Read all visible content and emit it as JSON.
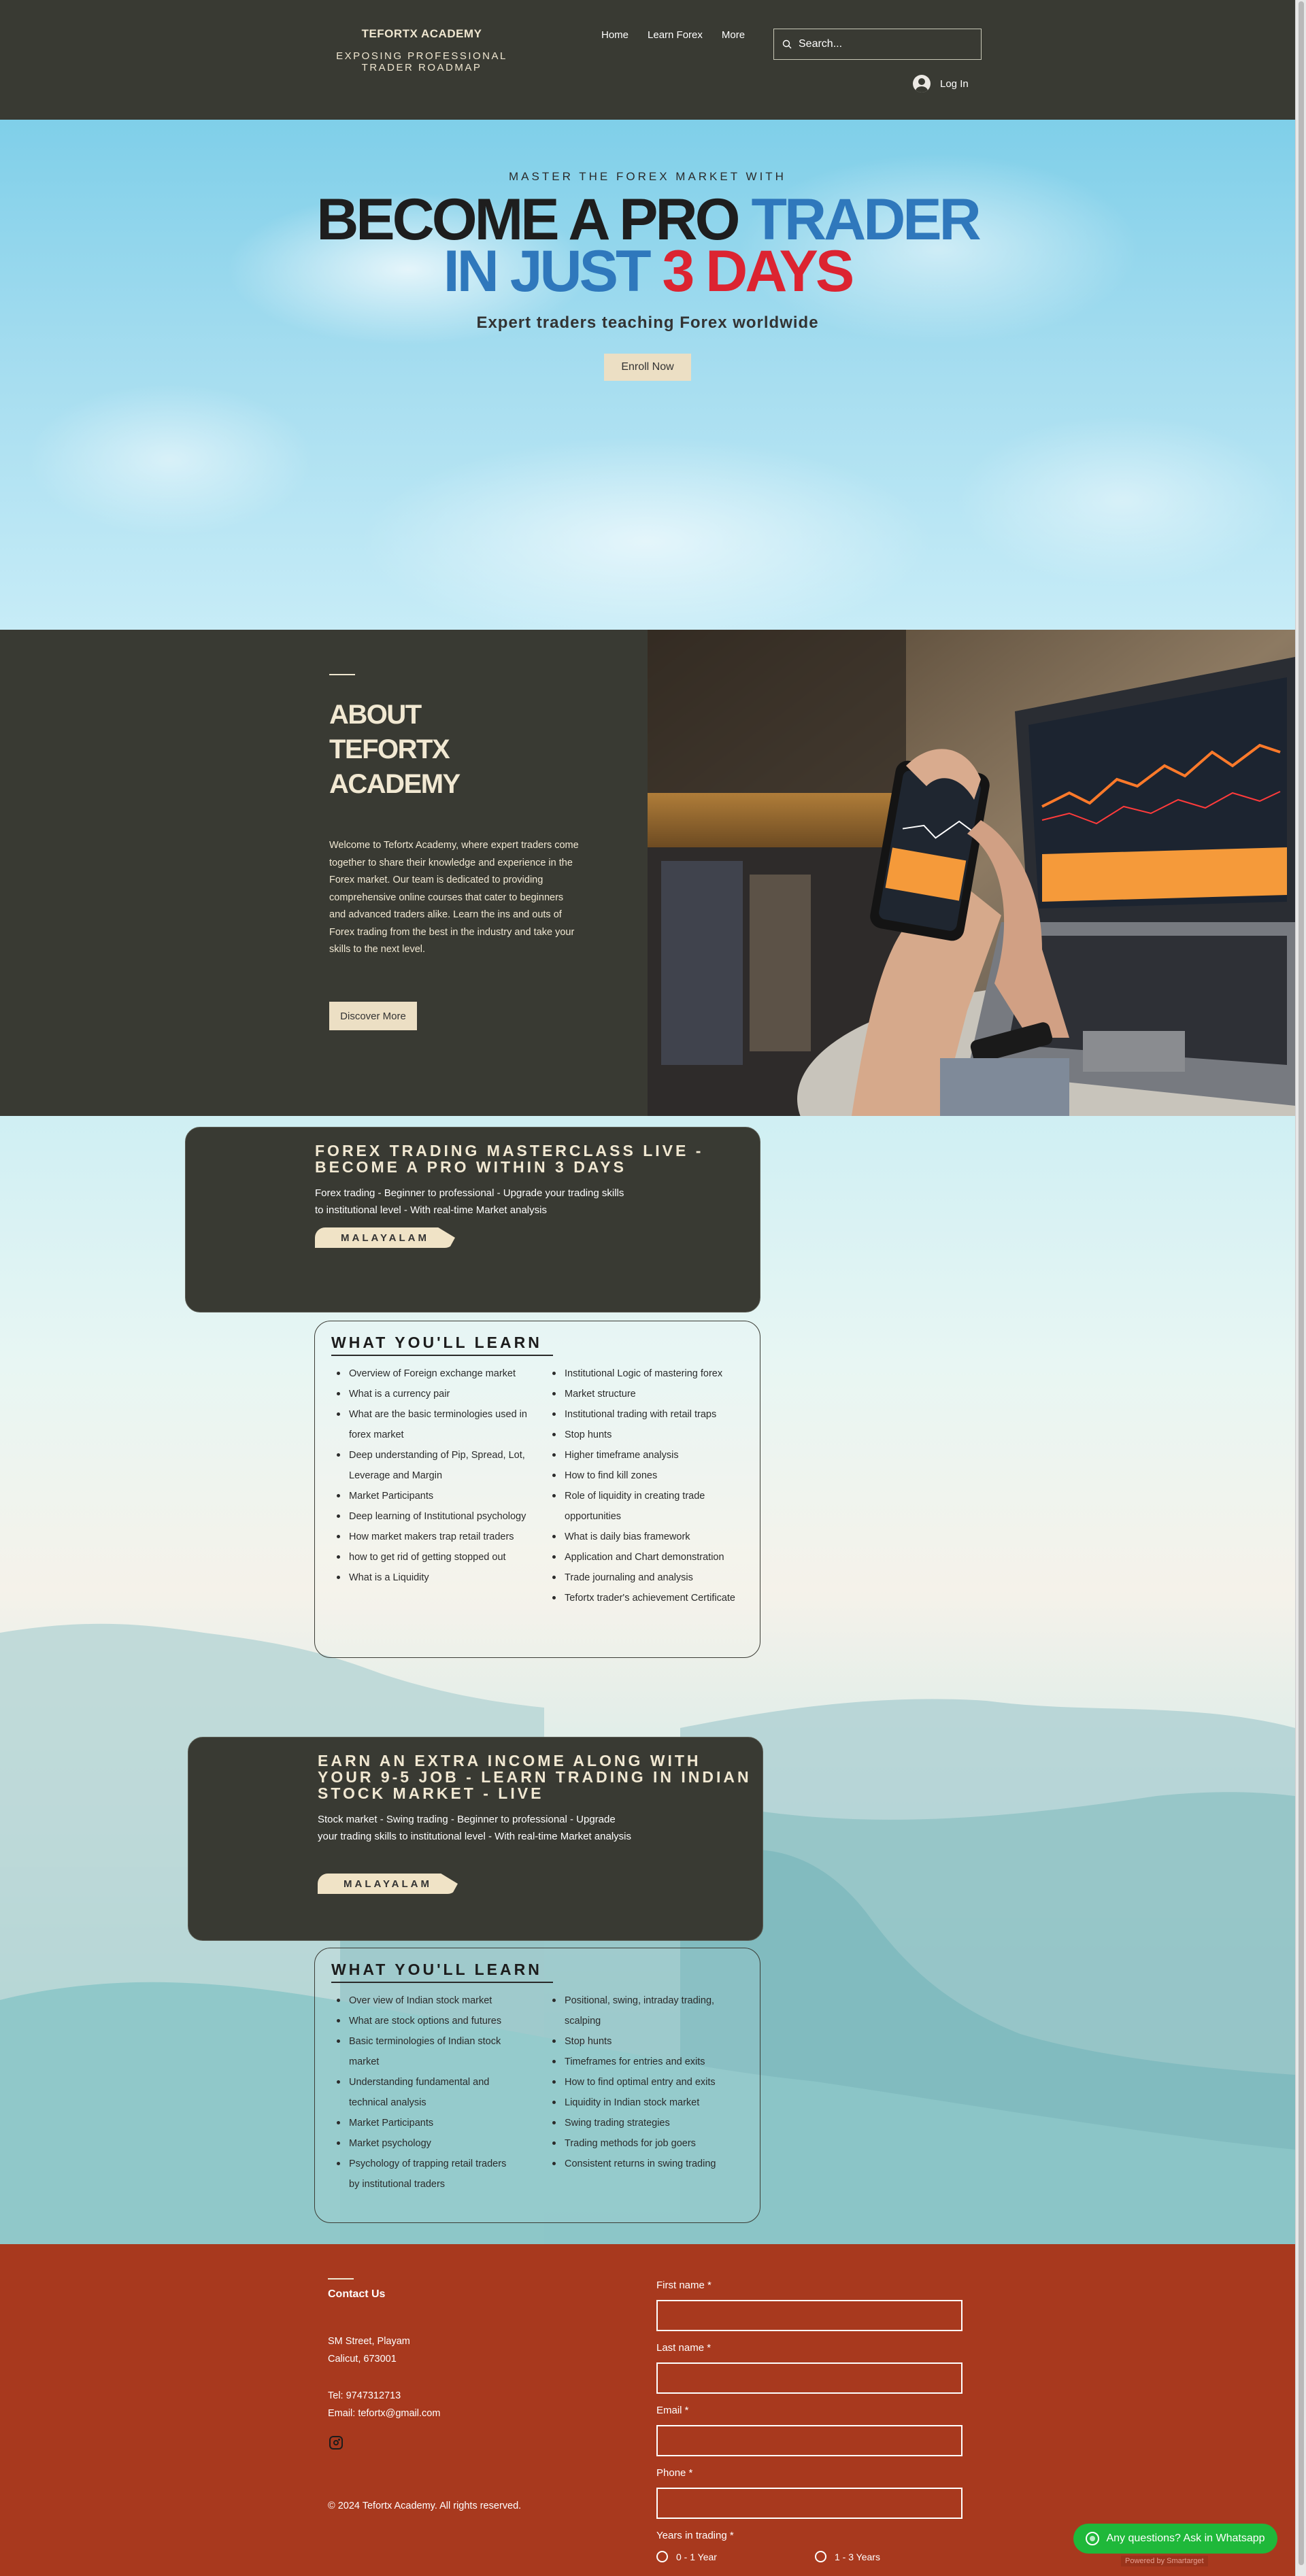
{
  "header": {
    "brand_title": "TEFORTX ACADEMY",
    "brand_tagline": "EXPOSING PROFESSIONAL TRADER ROADMAP",
    "nav": [
      "Home",
      "Learn Forex",
      "More"
    ],
    "search_placeholder": "Search...",
    "login_label": "Log In"
  },
  "hero": {
    "kicker": "MASTER THE FOREX MARKET WITH",
    "line1_a": "BECOME A PRO",
    "line1_b": "TRADER",
    "line2_a": "IN JUST",
    "line2_b": "3 DAYS",
    "subtitle": "Expert traders teaching Forex worldwide",
    "cta": "Enroll Now"
  },
  "about": {
    "title": "ABOUT TEFORTX ACADEMY",
    "text": "Welcome to Tefortx Academy, where expert traders come together to share their knowledge and experience in the Forex market. Our team is dedicated to providing comprehensive online courses that cater to beginners and advanced traders alike. Learn the ins and outs of Forex trading from the best in the industry and take your skills to the next level.",
    "cta": "Discover More"
  },
  "course1": {
    "title": "FOREX TRADING MASTERCLASS LIVE - BECOME A PRO WITHIN 3 DAYS",
    "description": "Forex trading - Beginner to professional - Upgrade your trading skills to institutional level - With real-time Market analysis",
    "language": "MALAYALAM",
    "learn_title": "WHAT YOU'LL LEARN",
    "left": [
      "Overview of Foreign exchange market",
      "What is a currency pair",
      "What are the basic terminologies used in forex market",
      "Deep understanding of Pip, Spread, Lot, Leverage and Margin",
      "Market Participants",
      "Deep learning of Institutional psychology",
      "How market makers trap retail traders",
      "how to get rid of getting stopped out",
      "What is a Liquidity"
    ],
    "right": [
      "Institutional Logic of mastering forex",
      "Market structure",
      "Institutional trading with retail traps",
      "Stop hunts",
      "Higher timeframe analysis",
      "How to find kill zones",
      "Role of liquidity in creating trade opportunities",
      "What is daily bias framework",
      "Application and Chart demonstration",
      "Trade journaling and analysis",
      "Tefortx trader's achievement Certificate"
    ]
  },
  "course2": {
    "title": "EARN AN EXTRA INCOME ALONG WITH YOUR 9-5 JOB - LEARN TRADING IN INDIAN STOCK MARKET - LIVE",
    "description": "Stock market - Swing trading - Beginner to professional - Upgrade your trading skills to institutional level - With real-time Market analysis",
    "language": "MALAYALAM",
    "learn_title": "WHAT YOU'LL LEARN",
    "left": [
      "Over view of Indian stock market",
      "What are stock options and futures",
      "Basic terminologies of Indian stock market",
      "Understanding fundamental and technical analysis",
      "Market Participants",
      "Market psychology",
      "Psychology of trapping retail traders by institutional traders"
    ],
    "right": [
      "Positional, swing, intraday trading, scalping",
      "Stop hunts",
      "Timeframes for entries and exits",
      "How to find optimal entry and exits",
      "Liquidity in Indian stock market",
      "Swing trading strategies",
      "Trading methods for job goers",
      "Consistent returns in swing trading"
    ]
  },
  "contact": {
    "title": "Contact Us",
    "address_line1": "SM Street, Playam",
    "address_line2": "Calicut, 673001",
    "tel": "Tel: 9747312713",
    "email": "Email: tefortx@gmail.com",
    "copyright": "© 2024 Tefortx Academy. All rights reserved.",
    "form": {
      "first_name": "First name *",
      "last_name": "Last name *",
      "email": "Email *",
      "phone": "Phone *",
      "years_label": "Years in trading *",
      "options": [
        "0 - 1 Year",
        "1 - 3 Years"
      ]
    }
  },
  "widgets": {
    "whatsapp": "Any questions? Ask in Whatsapp",
    "powered": "Powered by Smartarget"
  },
  "colors": {
    "header_bg": "#393a33",
    "cream": "#efe6d0",
    "blue": "#2f78bc",
    "red": "#dc2431",
    "contact_bg": "#a8391e",
    "whatsapp": "#1fb83a"
  }
}
